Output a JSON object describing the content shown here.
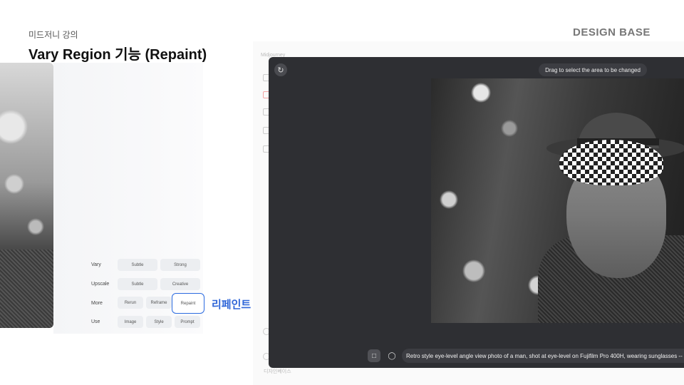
{
  "header": {
    "subtitle": "미드저니 강의",
    "title": "Vary Region 기능 (Repaint)",
    "brand": "DESIGN BASE"
  },
  "options": {
    "rows": [
      {
        "label": "Vary",
        "buttons": [
          "Subtle",
          "Strong"
        ]
      },
      {
        "label": "Upscale",
        "buttons": [
          "Subtle",
          "Creative"
        ]
      },
      {
        "label": "More",
        "buttons": [
          "Rerun",
          "Reframe",
          "Repaint"
        ]
      },
      {
        "label": "Use",
        "buttons": [
          "Image",
          "Style",
          "Prompt"
        ]
      }
    ],
    "highlighted": "Repaint",
    "callout": "리페인트"
  },
  "background_app": {
    "sidebar_title": "Midjourney",
    "footer_user": "디자인베이스"
  },
  "editor": {
    "reset_icon": "reset-icon",
    "tooltip": "Drag to select the area to be changed",
    "tools": [
      "rectangle-select-icon",
      "lasso-icon"
    ],
    "prompt": "Retro style eye-level angle view photo of a man, shot at eye-level on Fujifilm Pro 400H, wearing sunglasses --"
  },
  "colors": {
    "accent": "#2c6be0",
    "callout": "#2f66d8",
    "editor_bg": "#2e2f33"
  }
}
